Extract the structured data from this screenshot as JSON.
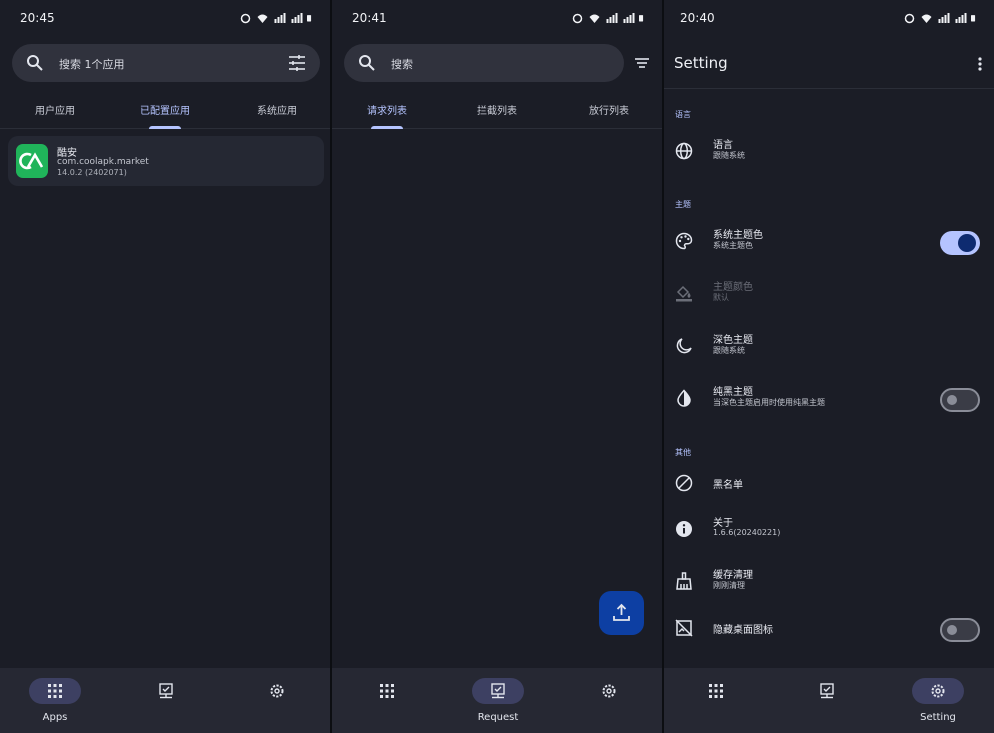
{
  "status_bars": [
    {
      "time": "20:45"
    },
    {
      "time": "20:41"
    },
    {
      "time": "20:40"
    }
  ],
  "apps_screen": {
    "search_placeholder": "搜索 1个应用",
    "tabs": [
      {
        "label": "用户应用"
      },
      {
        "label": "已配置应用"
      },
      {
        "label": "系统应用"
      }
    ],
    "active_tab": "已配置应用",
    "app_list": [
      {
        "name": "酷安",
        "package": "com.coolapk.market",
        "version": "14.0.2 (2402071)",
        "icon_color": "#20b45a"
      }
    ]
  },
  "request_screen": {
    "search_placeholder": "搜索",
    "tabs": [
      {
        "label": "请求列表"
      },
      {
        "label": "拦截列表"
      },
      {
        "label": "放行列表"
      }
    ],
    "active_tab": "请求列表"
  },
  "settings_screen": {
    "title": "Setting",
    "sections": [
      {
        "header": "语言",
        "items": [
          {
            "title": "语言",
            "subtitle": "跟随系统",
            "icon": "globe-icon"
          }
        ]
      },
      {
        "header": "主题",
        "items": [
          {
            "title": "系统主题色",
            "subtitle": "系统主题色",
            "icon": "palette-icon",
            "toggle": true
          },
          {
            "title": "主题颜色",
            "subtitle": "默认",
            "icon": "paint-bucket-icon",
            "disabled": true
          },
          {
            "title": "深色主题",
            "subtitle": "跟随系统",
            "icon": "moon-icon"
          },
          {
            "title": "纯黑主题",
            "subtitle": "当深色主题启用时使用纯黑主题",
            "icon": "contrast-icon",
            "toggle": false
          }
        ]
      },
      {
        "header": "其他",
        "items": [
          {
            "title": "黑名单",
            "icon": "block-icon"
          },
          {
            "title": "关于",
            "subtitle": "1.6.6(20240221)",
            "icon": "info-icon"
          },
          {
            "title": "缓存清理",
            "subtitle": "刚刚清理",
            "icon": "broom-icon"
          },
          {
            "title": "隐藏桌面图标",
            "icon": "hide-image-icon",
            "toggle": false
          }
        ]
      }
    ]
  },
  "nav": {
    "apps": "Apps",
    "request": "Request",
    "setting": "Setting"
  },
  "colors": {
    "background": "#1b1d26",
    "accent": "#b5c4ff",
    "nav_bar": "#262833",
    "fab": "#0d3fa3",
    "toggle_on_knob": "#0e2b70"
  }
}
